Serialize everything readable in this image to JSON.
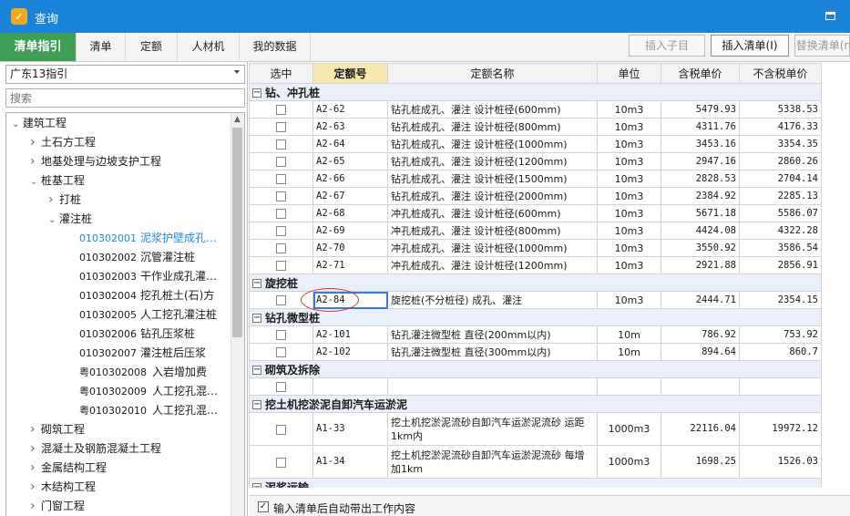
{
  "window": {
    "title": "查询",
    "maximize_icon": "maximize-icon"
  },
  "tabs": [
    {
      "label": "清单指引",
      "active": true
    },
    {
      "label": "清单"
    },
    {
      "label": "定额"
    },
    {
      "label": "人材机"
    },
    {
      "label": "我的数据"
    }
  ],
  "toolbar": {
    "insert_child": "插入子目",
    "insert_bill": "插入清单(I)",
    "replace_bill": "替换清单(r"
  },
  "left": {
    "region_select": "广东13指引",
    "search_placeholder": "搜索",
    "tree": [
      {
        "level": 0,
        "expanded": true,
        "name": "建筑工程"
      },
      {
        "level": 1,
        "expanded": false,
        "name": "土石方工程"
      },
      {
        "level": 1,
        "expanded": false,
        "name": "地基处理与边坡支护工程"
      },
      {
        "level": 1,
        "expanded": true,
        "name": "桩基工程"
      },
      {
        "level": 2,
        "expanded": false,
        "name": "打桩"
      },
      {
        "level": 2,
        "expanded": true,
        "name": "灌注桩"
      },
      {
        "level": 3,
        "code": "010302001",
        "name": "泥浆护壁成孔…",
        "selected": true
      },
      {
        "level": 3,
        "code": "010302002",
        "name": "沉管灌注桩"
      },
      {
        "level": 3,
        "code": "010302003",
        "name": "干作业成孔灌…"
      },
      {
        "level": 3,
        "code": "010302004",
        "name": "挖孔桩土(石)方"
      },
      {
        "level": 3,
        "code": "010302005",
        "name": "人工挖孔灌注桩"
      },
      {
        "level": 3,
        "code": "010302006",
        "name": "钻孔压浆桩"
      },
      {
        "level": 3,
        "code": "010302007",
        "name": "灌注桩后压浆"
      },
      {
        "level": 3,
        "code": "粤010302008",
        "name": "入岩增加费"
      },
      {
        "level": 3,
        "code": "粤010302009",
        "name": "人工挖孔混…"
      },
      {
        "level": 3,
        "code": "粤010302010",
        "name": "人工挖孔混…"
      },
      {
        "level": 1,
        "expanded": false,
        "name": "砌筑工程"
      },
      {
        "level": 1,
        "expanded": false,
        "name": "混凝土及钢筋混凝土工程"
      },
      {
        "level": 1,
        "expanded": false,
        "name": "金属结构工程"
      },
      {
        "level": 1,
        "expanded": false,
        "name": "木结构工程"
      },
      {
        "level": 1,
        "expanded": false,
        "name": "门窗工程"
      }
    ]
  },
  "grid": {
    "columns": [
      "选中",
      "定额号",
      "定额名称",
      "单位",
      "含税单价",
      "不含税单价"
    ],
    "groups": [
      {
        "name": "钻、冲孔桩",
        "rows": [
          {
            "code": "A2-62",
            "name": "钻孔桩成孔、灌注 设计桩径(600mm)",
            "unit": "10m3",
            "tax": "5479.93",
            "notax": "5338.53"
          },
          {
            "code": "A2-63",
            "name": "钻孔桩成孔、灌注 设计桩径(800mm)",
            "unit": "10m3",
            "tax": "4311.76",
            "notax": "4176.33"
          },
          {
            "code": "A2-64",
            "name": "钻孔桩成孔、灌注 设计桩径(1000mm)",
            "unit": "10m3",
            "tax": "3453.16",
            "notax": "3354.35"
          },
          {
            "code": "A2-65",
            "name": "钻孔桩成孔、灌注 设计桩径(1200mm)",
            "unit": "10m3",
            "tax": "2947.16",
            "notax": "2860.26"
          },
          {
            "code": "A2-66",
            "name": "钻孔桩成孔、灌注 设计桩径(1500mm)",
            "unit": "10m3",
            "tax": "2828.53",
            "notax": "2704.14"
          },
          {
            "code": "A2-67",
            "name": "钻孔桩成孔、灌注 设计桩径(2000mm)",
            "unit": "10m3",
            "tax": "2384.92",
            "notax": "2285.13"
          },
          {
            "code": "A2-68",
            "name": "冲孔桩成孔、灌注 设计桩径(600mm)",
            "unit": "10m3",
            "tax": "5671.18",
            "notax": "5586.07"
          },
          {
            "code": "A2-69",
            "name": "冲孔桩成孔、灌注 设计桩径(800mm)",
            "unit": "10m3",
            "tax": "4424.08",
            "notax": "4322.28"
          },
          {
            "code": "A2-70",
            "name": "冲孔桩成孔、灌注 设计桩径(1000mm)",
            "unit": "10m3",
            "tax": "3550.92",
            "notax": "3586.54"
          },
          {
            "code": "A2-71",
            "name": "冲孔桩成孔、灌注 设计桩径(1200mm)",
            "unit": "10m3",
            "tax": "2921.88",
            "notax": "2856.91"
          }
        ]
      },
      {
        "name": "旋挖桩",
        "rows": [
          {
            "code": "A2-84",
            "name": "旋挖桩(不分桩径) 成孔、灌注",
            "unit": "10m3",
            "tax": "2444.71",
            "notax": "2354.15",
            "focus": true
          }
        ]
      },
      {
        "name": "钻孔微型桩",
        "rows": [
          {
            "code": "A2-101",
            "name": "钻孔灌注微型桩 直径(200mm以内)",
            "unit": "10m",
            "tax": "786.92",
            "notax": "753.92"
          },
          {
            "code": "A2-102",
            "name": "钻孔灌注微型桩 直径(300mm以内)",
            "unit": "10m",
            "tax": "894.64",
            "notax": "860.7"
          }
        ]
      },
      {
        "name": "砌筑及拆除",
        "rows": [
          {
            "code": "",
            "name": "",
            "unit": "",
            "tax": "",
            "notax": ""
          }
        ]
      },
      {
        "name": "挖土机挖淤泥自卸汽车运淤泥",
        "rows": [
          {
            "code": "A1-33",
            "name": "挖土机挖淤泥流砂自卸汽车运淤泥流砂 运距1km内",
            "unit": "1000m3",
            "tax": "22116.04",
            "notax": "19972.12",
            "tall": true
          },
          {
            "code": "A1-34",
            "name": "挖土机挖淤泥流砂自卸汽车运淤泥流砂 每增加1km",
            "unit": "1000m3",
            "tax": "1698.25",
            "notax": "1526.03",
            "tall": true
          }
        ]
      },
      {
        "name": "泥浆运输",
        "rows": []
      }
    ]
  },
  "footer": {
    "checkbox_label": "输入清单后自动带出工作内容",
    "checked": true,
    "check_mark": "✓"
  }
}
